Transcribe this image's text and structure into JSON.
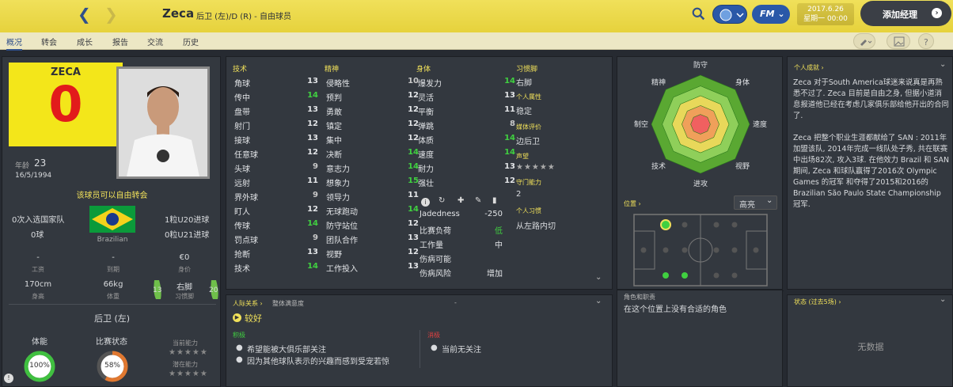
{
  "header": {
    "player_name": "Zeca",
    "subtitle": "后卫 (左)/D (R) - 自由球员",
    "date_line1": "2017.6.26",
    "date_line2": "星期一 00:00",
    "add_manager": "添加经理",
    "fm_label": "FM"
  },
  "tabs": [
    {
      "label": "概况"
    },
    {
      "label": "转会"
    },
    {
      "label": "成长"
    },
    {
      "label": "报告"
    },
    {
      "label": "交流"
    },
    {
      "label": "历史"
    }
  ],
  "card": {
    "shirt_name": "ZECA",
    "shirt_number": "0",
    "age_label": "年龄",
    "age": "23",
    "dob": "16/5/1994",
    "transfer_note": "该球员可以自由转会",
    "caps_left1": "0次入选国家队",
    "caps_left2": "0球",
    "u20": "1粒U20进球",
    "u21": "0粒U21进球",
    "nation": "Brazilian",
    "wage_val": "-",
    "wage_lbl": "工资",
    "expiry_val": "-",
    "expiry_lbl": "到期",
    "value_val": "€0",
    "value_lbl": "身价",
    "height_val": "170cm",
    "height_lbl": "身高",
    "weight_val": "66kg",
    "weight_lbl": "体重",
    "foot_val": "右脚",
    "foot_lbl": "习惯脚",
    "left_foot": "13",
    "right_foot": "20",
    "position": "后卫 (左)",
    "cond_lbl": "体能",
    "cond_val": "100%",
    "form_lbl": "比赛状态",
    "form_val": "58%",
    "cur_ability": "当前能力",
    "pot_ability": "潜在能力",
    "cond_pct": 100,
    "form_pct": 58
  },
  "attributes": {
    "tech_h": "技术",
    "mental_h": "精神",
    "phys_h": "身体",
    "technical": [
      [
        "角球",
        "13"
      ],
      [
        "传中",
        "14"
      ],
      [
        "盘带",
        "13"
      ],
      [
        "射门",
        "12"
      ],
      [
        "接球",
        "13"
      ],
      [
        "任意球",
        "12"
      ],
      [
        "头球",
        "9"
      ],
      [
        "远射",
        "11"
      ],
      [
        "界外球",
        "9"
      ],
      [
        "盯人",
        "12"
      ],
      [
        "传球",
        "14"
      ],
      [
        "罚点球",
        "9"
      ],
      [
        "抢断",
        "13"
      ],
      [
        "技术",
        "14"
      ]
    ],
    "mental": [
      [
        "侵略性",
        "10"
      ],
      [
        "预判",
        "12"
      ],
      [
        "勇敢",
        "12"
      ],
      [
        "镇定",
        "12"
      ],
      [
        "集中",
        "12"
      ],
      [
        "决断",
        "14"
      ],
      [
        "意志力",
        "14"
      ],
      [
        "想象力",
        "15"
      ],
      [
        "领导力",
        "11"
      ],
      [
        "无球跑动",
        "14"
      ],
      [
        "防守站位",
        "12"
      ],
      [
        "团队合作",
        "13"
      ],
      [
        "视野",
        "12"
      ],
      [
        "工作投入",
        "13"
      ]
    ],
    "physical": [
      [
        "爆发力",
        "14"
      ],
      [
        "灵活",
        "13"
      ],
      [
        "平衡",
        "11"
      ],
      [
        "弹跳",
        "8"
      ],
      [
        "体质",
        "14"
      ],
      [
        "速度",
        "14"
      ],
      [
        "耐力",
        "13"
      ],
      [
        "强壮",
        "12"
      ]
    ],
    "extra": [
      [
        "Jadedness",
        "-250"
      ],
      [
        "比赛负荷",
        "低"
      ],
      [
        "工作量",
        "中"
      ],
      [
        "伤病可能",
        ""
      ],
      [
        "伤病风险",
        "增加"
      ]
    ]
  },
  "info": {
    "foot_h": "习惯脚",
    "foot": "右脚",
    "pers_h": "个人属性",
    "pers": "稳定",
    "media_h": "媒体评价",
    "media": "边后卫",
    "rep_h": "声望",
    "rep": "★★★★★",
    "gk_h": "守门能力",
    "gk": "2",
    "habit_h": "个人习惯",
    "habit": "从左路内切"
  },
  "radar": {
    "labels": [
      "防守",
      "身体",
      "速度",
      "视野",
      "进攻",
      "技术",
      "制空",
      "精神"
    ],
    "pos_label": "位置 ›",
    "highlight": "高亮",
    "role_h": "角色和职责",
    "role_txt": "在这个位置上没有合适的角色"
  },
  "relations": {
    "h1": "人际关系 ›",
    "h2": "整体满意度",
    "h3": "-",
    "mood": "较好",
    "pos_h": "积极",
    "pos1": "希望能被大俱乐部关注",
    "pos2": "因为其他球队表示的兴趣而感到受宠若惊",
    "neg_h": "消极",
    "neg1": "当前无关注"
  },
  "bio": {
    "h": "个人成就 ›",
    "p1": "Zeca 对于South America球迷来说真是再熟悉不过了. Zeca 目前是自由之身, 但据小道消息报道他已经在考虑几家俱乐部给他开出的合同了.",
    "p2": "Zeca 把整个职业生涯都献给了 SAN : 2011年加盟该队, 2014年完成一线队处子秀, 共在联赛中出场82次, 攻入3球. 在他效力 Brazil 和 SAN 期间, Zeca 和球队赢得了2016次 Olympic Games 的冠军 和夺得了2015和2016的 Brazilian São Paulo State Championship 冠军.",
    "status_h": "状态 (过去5场) ›",
    "no_data": "无数据"
  },
  "colors": {
    "accent": "#f0e05a",
    "panel": "#33383f",
    "green": "#40d040",
    "blue": "#2f4f8a"
  }
}
